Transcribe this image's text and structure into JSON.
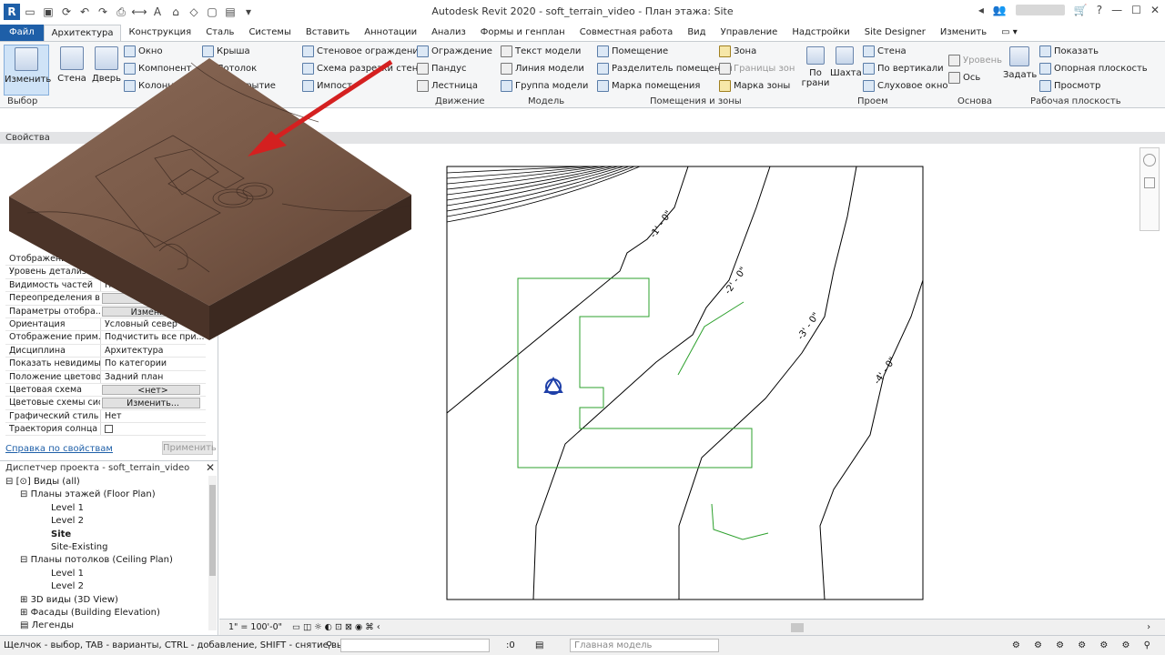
{
  "window": {
    "title": "Autodesk Revit 2020 - soft_terrain_video - План этажа: Site"
  },
  "tabs": [
    {
      "label": "Файл"
    },
    {
      "label": "Архитектура"
    },
    {
      "label": "Конструкция"
    },
    {
      "label": "Сталь"
    },
    {
      "label": "Системы"
    },
    {
      "label": "Вставить"
    },
    {
      "label": "Аннотации"
    },
    {
      "label": "Анализ"
    },
    {
      "label": "Формы и генплан"
    },
    {
      "label": "Совместная работа"
    },
    {
      "label": "Вид"
    },
    {
      "label": "Управление"
    },
    {
      "label": "Надстройки"
    },
    {
      "label": "Site Designer"
    },
    {
      "label": "Изменить"
    }
  ],
  "ribbon": {
    "modify": "Изменить",
    "wall": "Стена",
    "door": "Дверь",
    "window": "Окно",
    "component": "Компонент",
    "column": "Колонна",
    "roof": "Крыша",
    "ceiling": "Потолок",
    "floor": "Перекрытие",
    "curtain_system": "Стеновое ограждение",
    "curtain_grid": "Схема разрезки стены",
    "mullion": "Импост",
    "railing": "Ограждение",
    "ramp": "Пандус",
    "stair": "Лестница",
    "model_text": "Текст модели",
    "model_line": "Линия модели",
    "model_group": "Группа модели",
    "room": "Помещение",
    "room_separator": "Разделитель помещений",
    "room_tag": "Марка помещения",
    "area": "Зона",
    "area_boundary": "Границы зон",
    "area_tag": "Марка зоны",
    "by_face": "По грани",
    "shaft": "Шахта",
    "opening_wall": "Стена",
    "opening_vertical": "По вертикали",
    "dormer": "Слуховое окно",
    "level": "Уровень",
    "grid": "Ось",
    "set": "Задать",
    "show": "Показать",
    "ref_plane": "Опорная плоскость",
    "viewer": "Просмотр",
    "panels": {
      "select": "Выбор",
      "circulation": "Движение",
      "model": "Модель",
      "rooms": "Помещения и зоны",
      "opening": "Проем",
      "datum": "Основа",
      "workplane": "Рабочая плоскость"
    }
  },
  "properties": {
    "header": "Свойства",
    "rows": [
      {
        "key": "Отображение мо",
        "value": ""
      },
      {
        "key": "Уровень детализации",
        "value": ""
      },
      {
        "key": "Видимость частей",
        "value": "Пока",
        "button": false
      },
      {
        "key": "Переопределения в...",
        "value": "Измен",
        "button": true
      },
      {
        "key": "Параметры отобра...",
        "value": "Изменить",
        "button": true
      },
      {
        "key": "Ориентация",
        "value": "Условный север",
        "button": false
      },
      {
        "key": "Отображение прим...",
        "value": "Подчистить все при...",
        "button": false
      },
      {
        "key": "Дисциплина",
        "value": "Архитектура",
        "button": false
      },
      {
        "key": "Показать невидимы...",
        "value": "По категории",
        "button": false
      },
      {
        "key": "Положение цветово...",
        "value": "Задний план",
        "button": false
      },
      {
        "key": "Цветовая схема",
        "value": "<нет>",
        "button": true
      },
      {
        "key": "Цветовые схемы сис...",
        "value": "Изменить...",
        "button": true
      },
      {
        "key": "Графический стиль ...",
        "value": "Нет",
        "button": false
      },
      {
        "key": "Траектория солнца",
        "value": "",
        "button": false
      }
    ],
    "help_link": "Справка по свойствам",
    "apply": "Применить"
  },
  "browser": {
    "title": "Диспетчер проекта - soft_terrain_video",
    "nodes": [
      {
        "label": "Виды (all)",
        "level": 0,
        "bold": false
      },
      {
        "label": "Планы этажей (Floor Plan)",
        "level": 1,
        "bold": false
      },
      {
        "label": "Level 1",
        "level": 2,
        "bold": false
      },
      {
        "label": "Level 2",
        "level": 2,
        "bold": false
      },
      {
        "label": "Site",
        "level": 2,
        "bold": true
      },
      {
        "label": "Site-Existing",
        "level": 2,
        "bold": false
      },
      {
        "label": "Планы потолков (Ceiling Plan)",
        "level": 1,
        "bold": false
      },
      {
        "label": "Level 1",
        "level": 2,
        "bold": false
      },
      {
        "label": "Level 2",
        "level": 2,
        "bold": false
      },
      {
        "label": "3D виды (3D View)",
        "level": 1,
        "bold": false
      },
      {
        "label": "Фасады (Building Elevation)",
        "level": 1,
        "bold": false
      },
      {
        "label": "Легенды",
        "level": 0,
        "bold": false
      }
    ]
  },
  "drawing": {
    "contours": [
      "-1' - 0\"",
      "-2' - 0\"",
      "-3' - 0\"",
      "-4' - 0\""
    ]
  },
  "viewbar": {
    "scale": "1\" = 100'-0\""
  },
  "status": {
    "hint": "Щелчок - выбор, TAB - варианты, CTRL - добавление, SHIFT - снятие выбора.",
    "workset_value": ":0",
    "model": "Главная модель"
  },
  "colors": {
    "accent": "#1e5fa8",
    "pad_green": "#2ca02c",
    "terrain": "#6b4a3a",
    "arrow": "#d42020"
  }
}
